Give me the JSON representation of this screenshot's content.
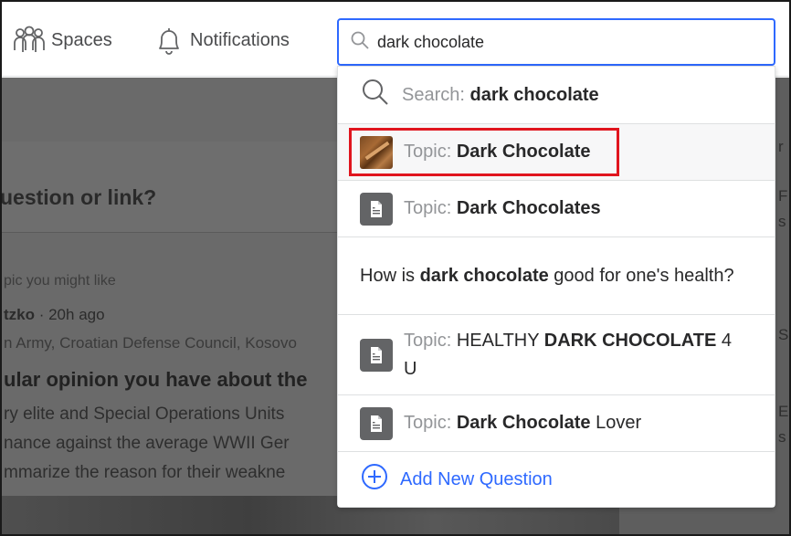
{
  "nav": {
    "spaces_label": "Spaces",
    "notifications_label": "Notifications"
  },
  "search": {
    "value": "dark chocolate"
  },
  "dropdown": {
    "search_row": {
      "prefix": "Search:",
      "term": "dark chocolate"
    },
    "topic_1": {
      "prefix": "Topic:",
      "name": "Dark Chocolate"
    },
    "topic_2": {
      "prefix": "Topic:",
      "name": "Dark Chocolates"
    },
    "question": {
      "pre": "How is ",
      "term": "dark chocolate",
      "post": " good for one's health?"
    },
    "topic_3": {
      "prefix": "Topic:",
      "pre": "HEALTHY ",
      "term": "DARK CHOCOLATE",
      "post": " 4 U"
    },
    "topic_4": {
      "prefix": "Topic:",
      "term": "Dark Chocolate",
      "post": " Lover"
    },
    "add_question_label": "Add New Question"
  },
  "background": {
    "ask_prompt": "uestion or link?",
    "suggested": "pic you might like",
    "author": "tzko",
    "time": " · 20h ago",
    "credentials": "n Army, Croatian Defense Council, Kosovo",
    "post_title": "ular opinion you have about the",
    "body_line_1": "ry elite and Special Operations Units",
    "body_line_2": "nance against the average WWII Ger",
    "body_line_3": "mmarize the reason for their weakne",
    "right_fragments": [
      "r",
      "F",
      "s",
      "S",
      "E",
      "s"
    ]
  },
  "colors": {
    "accent": "#2e69ff",
    "highlight_box": "#e0151e",
    "muted_text": "#939598",
    "text": "#282829"
  },
  "icons": {
    "spaces": "spaces-people-icon",
    "notifications": "bell-icon",
    "search": "search-icon",
    "topic_document": "topic-document-icon",
    "add": "plus-circle-icon"
  }
}
